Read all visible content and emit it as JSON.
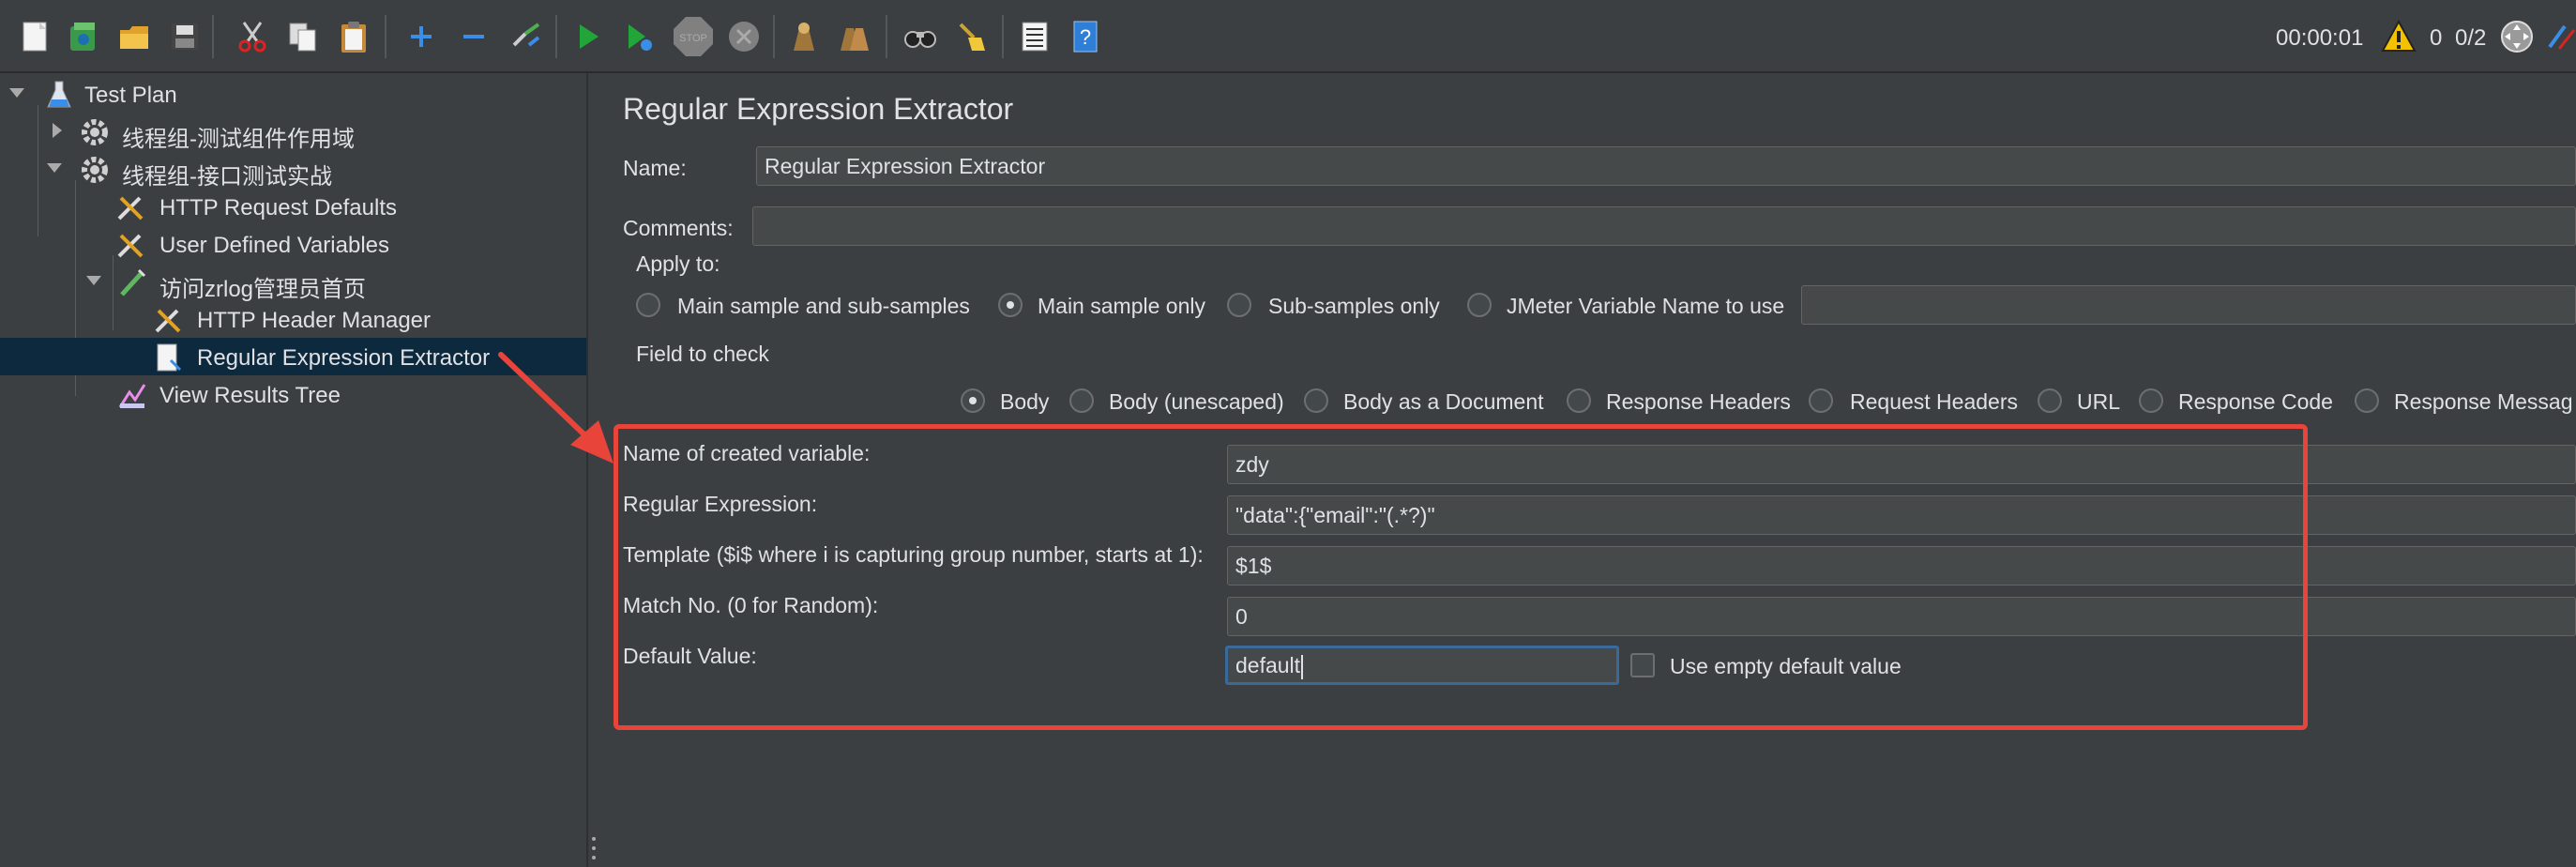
{
  "toolbar": {
    "buttons": [
      {
        "icon": "new-file-icon"
      },
      {
        "icon": "templates-icon"
      },
      {
        "icon": "open-icon"
      },
      {
        "icon": "save-icon"
      },
      {
        "icon": "cut-icon"
      },
      {
        "icon": "copy-icon"
      },
      {
        "icon": "paste-icon"
      },
      {
        "icon": "expand-icon"
      },
      {
        "icon": "collapse-icon"
      },
      {
        "icon": "toggle-icon"
      },
      {
        "icon": "start-icon"
      },
      {
        "icon": "start-no-pauses-icon"
      },
      {
        "icon": "stop-icon"
      },
      {
        "icon": "shutdown-icon"
      },
      {
        "icon": "clear-icon"
      },
      {
        "icon": "clear-all-icon"
      },
      {
        "icon": "search-icon"
      },
      {
        "icon": "reset-search-icon"
      },
      {
        "icon": "function-helper-icon"
      },
      {
        "icon": "help-icon"
      }
    ],
    "timer": "00:00:01",
    "warning_count": "0",
    "threads": "0/2",
    "stop_badge_text": "STOP"
  },
  "tree": {
    "items": [
      {
        "label": "Test Plan",
        "icon": "test-plan-icon"
      },
      {
        "label": "线程组-测试组件作用域",
        "icon": "thread-group-icon"
      },
      {
        "label": "线程组-接口测试实战",
        "icon": "thread-group-icon"
      },
      {
        "label": "HTTP Request Defaults",
        "icon": "config-element-icon"
      },
      {
        "label": "User Defined Variables",
        "icon": "config-element-icon"
      },
      {
        "label": "访问zrlog管理员首页",
        "icon": "sampler-icon"
      },
      {
        "label": "HTTP Header Manager",
        "icon": "config-element-icon"
      },
      {
        "label": "Regular Expression Extractor",
        "icon": "post-processor-icon"
      },
      {
        "label": "View Results Tree",
        "icon": "listener-icon"
      }
    ]
  },
  "panel": {
    "title": "Regular Expression Extractor",
    "name_label": "Name:",
    "name_value": "Regular Expression Extractor",
    "comments_label": "Comments:",
    "comments_value": "",
    "apply_to": {
      "legend": "Apply to:",
      "options": [
        "Main sample and sub-samples",
        "Main sample only",
        "Sub-samples only",
        "JMeter Variable Name to use"
      ],
      "selected": "Main sample only",
      "variable_name_value": ""
    },
    "field_to_check": {
      "legend": "Field to check",
      "options": [
        "Body",
        "Body (unescaped)",
        "Body as a Document",
        "Response Headers",
        "Request Headers",
        "URL",
        "Response Code",
        "Response Messag"
      ],
      "selected": "Body"
    },
    "fields": {
      "var_name_label": "Name of created variable:",
      "var_name_value": "zdy",
      "regex_label": "Regular Expression:",
      "regex_value": "\"data\":{\"email\":\"(.*?)\"",
      "template_label": "Template ($i$ where i is capturing group number, starts at 1):",
      "template_value": "$1$",
      "match_no_label": "Match No. (0 for Random):",
      "match_no_value": "0",
      "default_label": "Default Value:",
      "default_value": "default",
      "use_empty_label": "Use empty default value",
      "use_empty_checked": false
    }
  },
  "colors": {
    "background": "#3c3f41",
    "selection": "#0d293e",
    "annotation": "#e8443a",
    "text": "#dfe1e5"
  }
}
